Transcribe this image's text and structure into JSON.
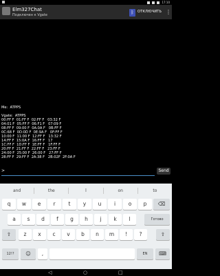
{
  "status": {
    "time": "17:10"
  },
  "app": {
    "title": "Elm327Chat",
    "subtitle": "Подключен к Vgate",
    "disconnect_label": "ОТКЛЮЧИТЬ",
    "overflow_glyph": "⋮",
    "bt_glyph": "ᛒ"
  },
  "chat": {
    "me_line": "Me:  ATPPS",
    "lines": [
      "Vgate:  ATPPS",
      "00:FF F  01:FF F  02:FF F   03:32 F",
      "04:01 F  05:FF F  06:F1 F   07:09 F",
      "08:FF F  09:00 F  0A:0A F   0B:FF F",
      "0C:68 F  0D:0D F  0E:9A F   0F:FF F",
      "10:00 F  11:00 F  12:FF F   13:32 F",
      "14:FF F  15:0A F  16:FF F   17",
      "1C:FF F  1D:FF F  1E:FF F   1F:FF F",
      "20:FF F  21:FF F  22:FF F   23:FF F",
      "24:00 F  25:00 F  26:00 F   27:FF F",
      "28:FF F  29:FF F  2A:38 F   2B:02F  2F:0A F"
    ]
  },
  "input": {
    "prompt": ">",
    "send_label": "Send"
  },
  "keyboard": {
    "suggestions": [
      "and",
      "the",
      "l",
      "on",
      "to"
    ],
    "row1": [
      "q",
      "w",
      "e",
      "r",
      "t",
      "y",
      "u",
      "i",
      "o",
      "p"
    ],
    "row2": [
      "a",
      "s",
      "d",
      "f",
      "g",
      "h",
      "j",
      "k",
      "l"
    ],
    "row3": [
      "z",
      "x",
      "c",
      "v",
      "b",
      "n",
      "m",
      "!",
      "?"
    ],
    "row4": {
      "sym": "12!?",
      "comma": ",",
      "period": ".",
      "lang": "EN"
    },
    "backspace_glyph": "⌫",
    "enter_label": "Готово",
    "shift_glyph": "⇧",
    "emoji_glyph": "☺",
    "mic_glyph": "⌨"
  },
  "nav": {
    "back": "◁",
    "home": "○",
    "recents": "□"
  }
}
